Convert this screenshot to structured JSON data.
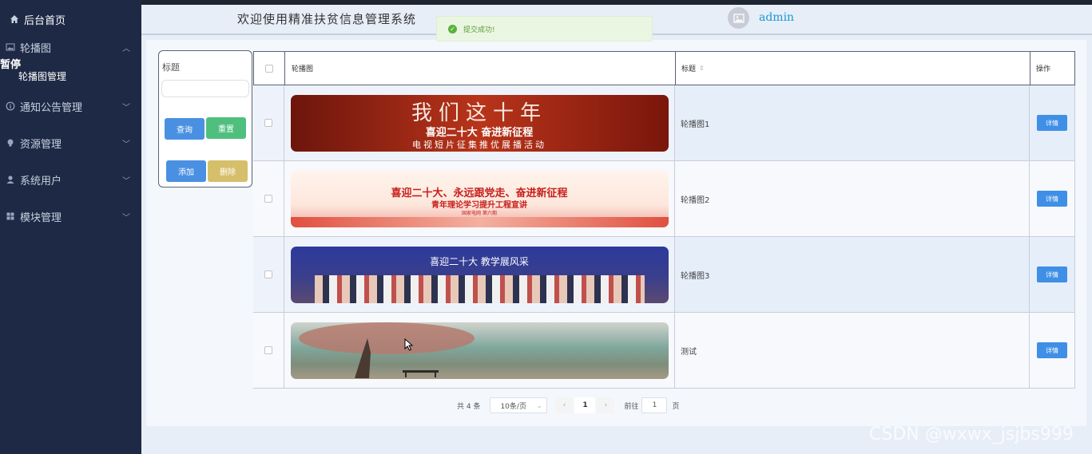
{
  "sidebar": {
    "home": "后台首页",
    "stray": "暂停",
    "sub_item": "轮播图管理",
    "items": [
      {
        "label": "轮播图",
        "icon": "image-icon"
      },
      {
        "label": "通知公告管理",
        "icon": "info-circle-icon"
      },
      {
        "label": "资源管理",
        "icon": "lightbulb-icon"
      },
      {
        "label": "系统用户",
        "icon": "user-icon"
      },
      {
        "label": "模块管理",
        "icon": "grid-icon"
      }
    ],
    "chevron": "⌄"
  },
  "header": {
    "welcome": "欢迎使用精准扶贫信息管理系统",
    "username": "admin"
  },
  "toast": {
    "message": "提交成功!",
    "icon": "check-circle-icon",
    "color": "#5ab13a"
  },
  "search": {
    "label": "标题",
    "placeholder": "",
    "query_btn": "查询",
    "reset_btn": "重置",
    "add_btn": "添加",
    "delete_btn": "删除"
  },
  "table": {
    "headers": {
      "image": "轮播图",
      "title": "标题",
      "action": "操作"
    },
    "rows": [
      {
        "title": "轮播图1",
        "action": "详情",
        "banner_text": "我们这十年",
        "banner_sub": "喜迎二十大 奋进新征程",
        "banner_sub2": "电视短片征集推优展播活动"
      },
      {
        "title": "轮播图2",
        "action": "详情",
        "banner_text": "喜迎二十大、永远跟党走、奋进新征程",
        "banner_sub": "青年理论学习提升工程宣讲",
        "banner_sub2": "国家电网 第六期"
      },
      {
        "title": "轮播图3",
        "action": "详情",
        "banner_text": "喜迎二十大 教学展风采",
        "banner_sub": "",
        "banner_sub2": ""
      },
      {
        "title": "测试",
        "action": "详情",
        "banner_text": "",
        "banner_sub": "",
        "banner_sub2": ""
      }
    ]
  },
  "pager": {
    "total": "共 4 条",
    "page_size": "10条/页",
    "current": "1",
    "goto_label": "前往",
    "goto_value": "1",
    "page_suffix": "页"
  },
  "watermark": "CSDN @wxwx_jsjbs999"
}
